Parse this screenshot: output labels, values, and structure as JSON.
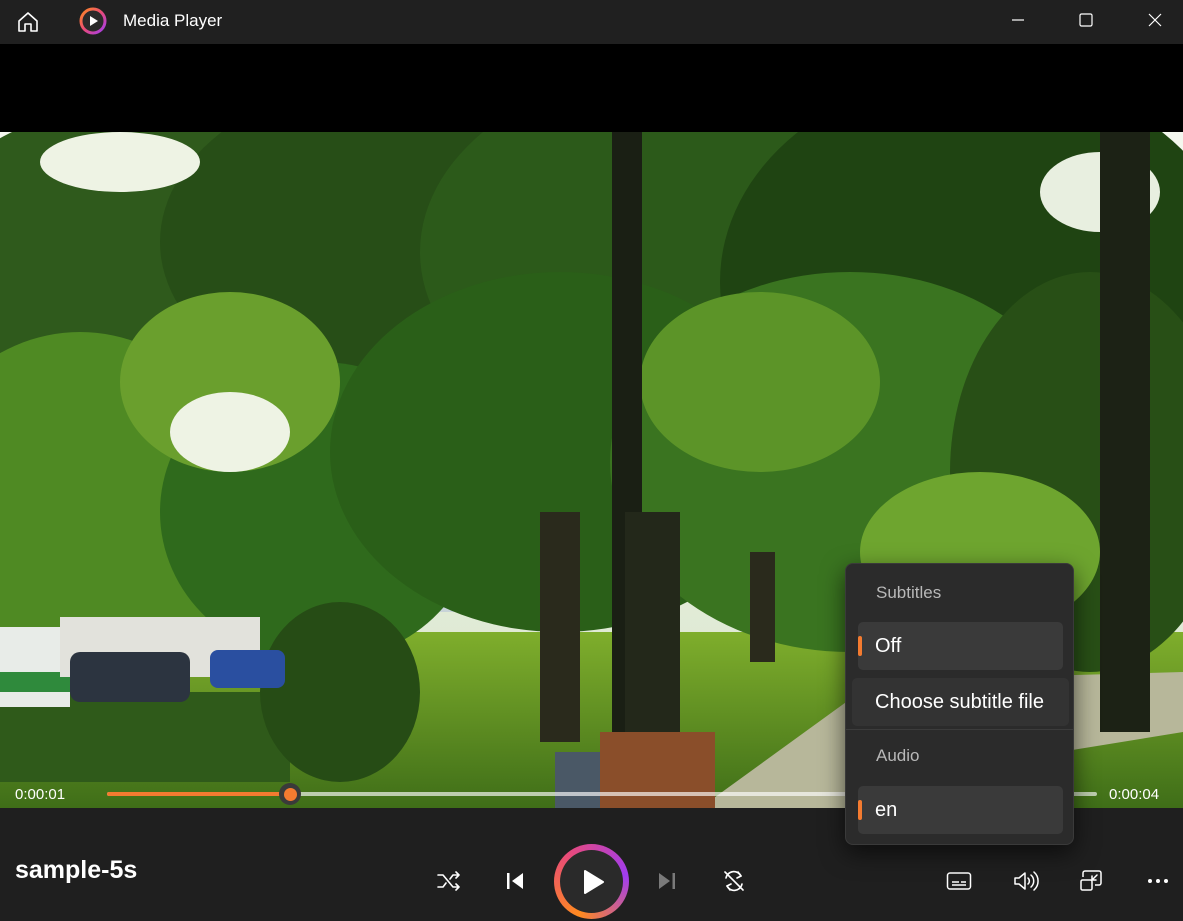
{
  "window": {
    "title": "Media Player",
    "minimize_label": "",
    "maximize_label": "",
    "close_label": ""
  },
  "player": {
    "file_name": "sample-5s",
    "current_time": "0:00:01",
    "duration": "0:00:04",
    "progress": 0.185,
    "accent_color": "#f47b30"
  },
  "flyout": {
    "subtitles_header": "Subtitles",
    "subtitles_options": [
      {
        "label": "Off",
        "selected": true
      },
      {
        "label": "Choose subtitle file",
        "selected": false
      }
    ],
    "audio_header": "Audio",
    "audio_options": [
      {
        "label": "en",
        "selected": true
      }
    ]
  },
  "icons": {
    "home": "home-icon",
    "app": "media-player-logo",
    "shuffle": "shuffle-icon",
    "previous": "previous-icon",
    "play": "play-icon",
    "next": "next-icon",
    "repeat": "repeat-icon",
    "subtitles": "subtitles-icon",
    "volume": "volume-icon",
    "mini_view": "mini-view-icon",
    "more": "more-icon"
  }
}
